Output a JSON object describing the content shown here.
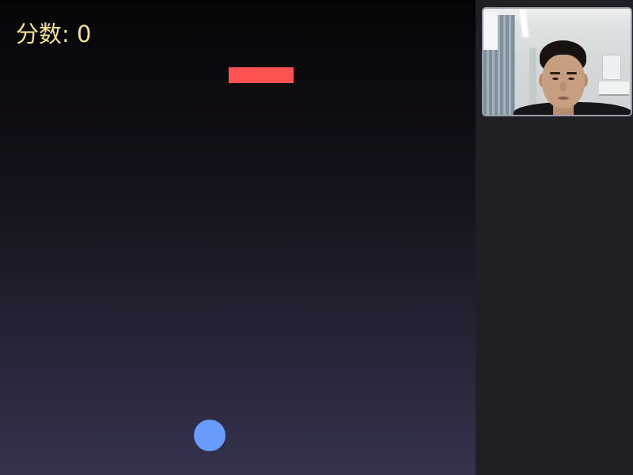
{
  "hud": {
    "score_label": "分数:",
    "score_value": 0,
    "text_color": "#f2e48e"
  },
  "game": {
    "background_top": "#050507",
    "background_bottom": "#35324e",
    "falling_block": {
      "color": "#ff5252"
    },
    "player_ball": {
      "color": "#6a9bff"
    }
  },
  "side_panel": {
    "background": "#1f1f25",
    "webcam_border": "#9a9ca8"
  }
}
